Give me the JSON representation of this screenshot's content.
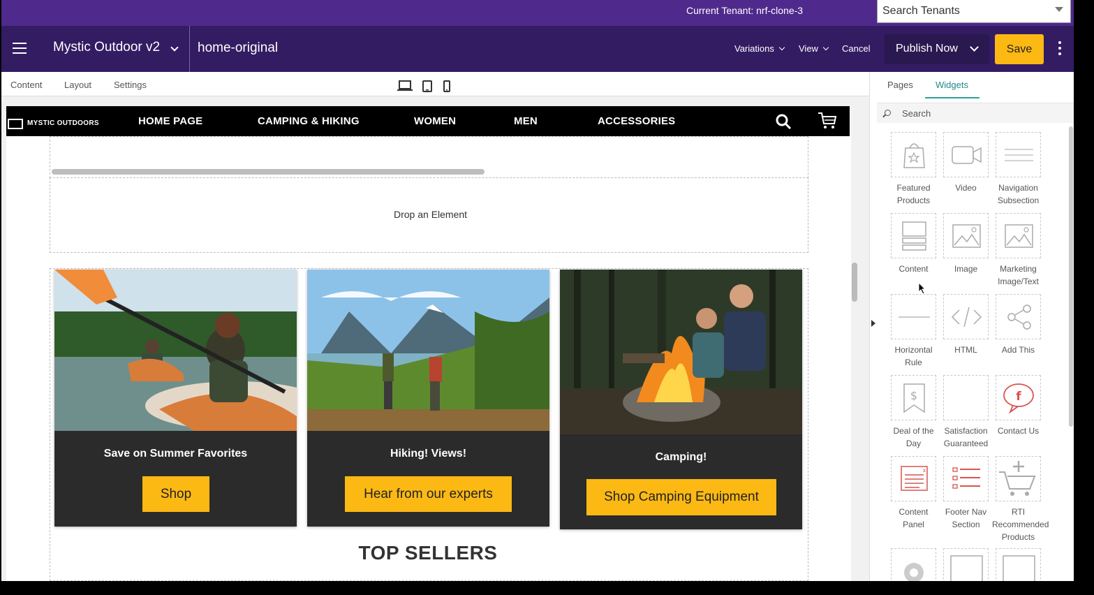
{
  "tenant_bar": {
    "label": "Current Tenant: nrf-clone-3",
    "search_placeholder": "Search Tenants"
  },
  "header": {
    "site_name": "Mystic Outdoor v2",
    "page_name": "home-original",
    "links": [
      "Variations",
      "View",
      "Cancel"
    ],
    "publish_label": "Publish Now",
    "save_label": "Save"
  },
  "editor_tabs": [
    "Content",
    "Layout",
    "Settings"
  ],
  "devices": [
    "desktop-icon",
    "tablet-icon",
    "phone-icon"
  ],
  "site": {
    "logo_text": "MYSTIC OUTDOORS",
    "nav": [
      "HOME PAGE",
      "CAMPING & HIKING",
      "WOMEN",
      "MEN",
      "ACCESSORIES"
    ],
    "drop_text": "Drop an Element",
    "cards": [
      {
        "heading": "Save on Summer Favorites",
        "button": "Shop"
      },
      {
        "heading": "Hiking! Views!",
        "button": "Hear from our experts"
      },
      {
        "heading": "Camping!",
        "button": "Shop Camping Equipment"
      }
    ],
    "section_title": "TOP SELLERS"
  },
  "panel": {
    "tabs": [
      "Pages",
      "Widgets"
    ],
    "active_tab": "Widgets",
    "search_placeholder": "Search",
    "widgets": [
      {
        "label": "Featured Products",
        "icon": "shopping-bag-icon"
      },
      {
        "label": "Video",
        "icon": "video-camera-icon"
      },
      {
        "label": "Navigation Subsection",
        "icon": "nav-lines-icon"
      },
      {
        "label": "Content",
        "icon": "content-block-icon"
      },
      {
        "label": "Image",
        "icon": "image-icon"
      },
      {
        "label": "Marketing Image/Text",
        "icon": "marketing-image-icon"
      },
      {
        "label": "Horizontal Rule",
        "icon": "horizontal-rule-icon"
      },
      {
        "label": "HTML",
        "icon": "code-icon"
      },
      {
        "label": "Add This",
        "icon": "share-icon"
      },
      {
        "label": "Deal of the Day",
        "icon": "dollar-tag-icon"
      },
      {
        "label": "Satisfaction Guaranteed",
        "icon": "blank-icon"
      },
      {
        "label": "Contact Us",
        "icon": "facebook-bubble-icon"
      },
      {
        "label": "Content Panel",
        "icon": "content-panel-icon"
      },
      {
        "label": "Footer Nav Section",
        "icon": "footer-nav-icon"
      },
      {
        "label": "RTI Recommended Products",
        "icon": "cart-plus-icon"
      }
    ]
  },
  "colors": {
    "tenant_bar": "#4f2a8c",
    "header": "#341c63",
    "accent": "#fdb913",
    "tab_active": "#2aa198",
    "card_bg": "#2b2b2b"
  }
}
